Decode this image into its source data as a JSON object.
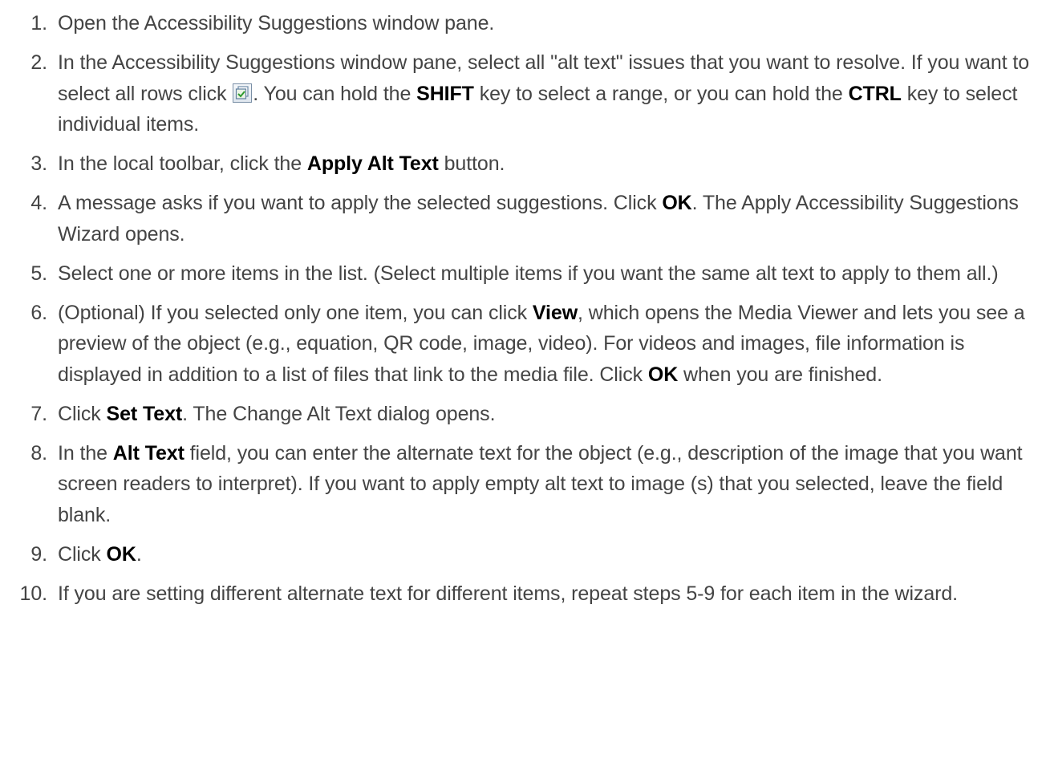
{
  "steps": [
    {
      "num": "1.",
      "parts": [
        {
          "t": "Open the Accessibility Suggestions window pane."
        }
      ]
    },
    {
      "num": "2.",
      "parts": [
        {
          "t": "In the Accessibility Suggestions window pane, select all \"alt text\" issues that you want to resolve. If you want to select all rows click "
        },
        {
          "icon": "select-all-icon"
        },
        {
          "t": ". You can hold the "
        },
        {
          "t": "SHIFT",
          "b": true
        },
        {
          "t": " key to select a range, or you can hold the "
        },
        {
          "t": "CTRL",
          "b": true
        },
        {
          "t": " key to select individual items."
        }
      ]
    },
    {
      "num": "3.",
      "parts": [
        {
          "t": "In the local toolbar, click the "
        },
        {
          "t": "Apply Alt Text",
          "b": true
        },
        {
          "t": " button."
        }
      ]
    },
    {
      "num": "4.",
      "parts": [
        {
          "t": "A message asks if you want to apply the selected suggestions. Click "
        },
        {
          "t": "OK",
          "b": true
        },
        {
          "t": ". The Apply Accessibility Suggestions Wizard opens."
        }
      ]
    },
    {
      "num": "5.",
      "parts": [
        {
          "t": "Select one or more items in the list. (Select multiple items if you want the same alt text to apply to them all.)"
        }
      ]
    },
    {
      "num": "6.",
      "parts": [
        {
          "t": "(Optional) If you selected only one item, you can click "
        },
        {
          "t": "View",
          "b": true
        },
        {
          "t": ", which opens the Media Viewer and lets you see a preview of the object (e.g., equation, QR code, image, video). For videos and images, file information is displayed in addition to a list of files that link to the media file. Click "
        },
        {
          "t": "OK",
          "b": true
        },
        {
          "t": " when you are finished."
        }
      ]
    },
    {
      "num": "7.",
      "parts": [
        {
          "t": "Click "
        },
        {
          "t": "Set Text",
          "b": true
        },
        {
          "t": ". The Change Alt Text dialog opens."
        }
      ]
    },
    {
      "num": "8.",
      "parts": [
        {
          "t": "In the "
        },
        {
          "t": "Alt Text",
          "b": true
        },
        {
          "t": " field, you can enter the alternate text for the object (e.g., description of the image that you want screen readers to interpret). If you want to apply empty alt text to image (s) that you selected, leave the field blank."
        }
      ]
    },
    {
      "num": "9.",
      "parts": [
        {
          "t": "Click "
        },
        {
          "t": "OK",
          "b": true
        },
        {
          "t": "."
        }
      ]
    },
    {
      "num": "10.",
      "parts": [
        {
          "t": "If you are setting different alternate text for different items, repeat steps 5-9 for each item in the wizard."
        }
      ]
    }
  ]
}
